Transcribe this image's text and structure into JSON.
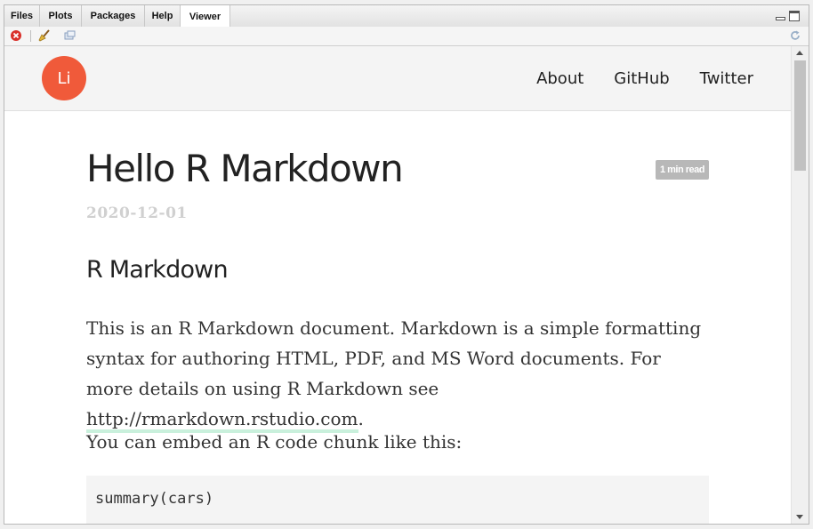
{
  "tabs": [
    {
      "label": "Files"
    },
    {
      "label": "Plots"
    },
    {
      "label": "Packages"
    },
    {
      "label": "Help"
    },
    {
      "label": "Viewer",
      "active": true
    }
  ],
  "toolbar": {
    "icons": [
      "close-icon",
      "broom-icon",
      "popout-icon",
      "refresh-icon"
    ]
  },
  "site": {
    "avatar_text": "Li",
    "avatar_color": "#f05a3a",
    "nav": [
      "About",
      "GitHub",
      "Twitter"
    ]
  },
  "post": {
    "title": "Hello R Markdown",
    "reading_time": "1 min read",
    "date": "2020-12-01",
    "heading": "R Markdown",
    "p1_text": "This is an R Markdown document. Markdown is a simple formatting syntax for authoring HTML, PDF, and MS Word documents. For more details on using R Markdown see ",
    "p1_link": "http://rmarkdown.rstudio.com",
    "p1_end": ".",
    "p2": "You can embed an R code chunk like this:",
    "code": "summary(cars)"
  }
}
